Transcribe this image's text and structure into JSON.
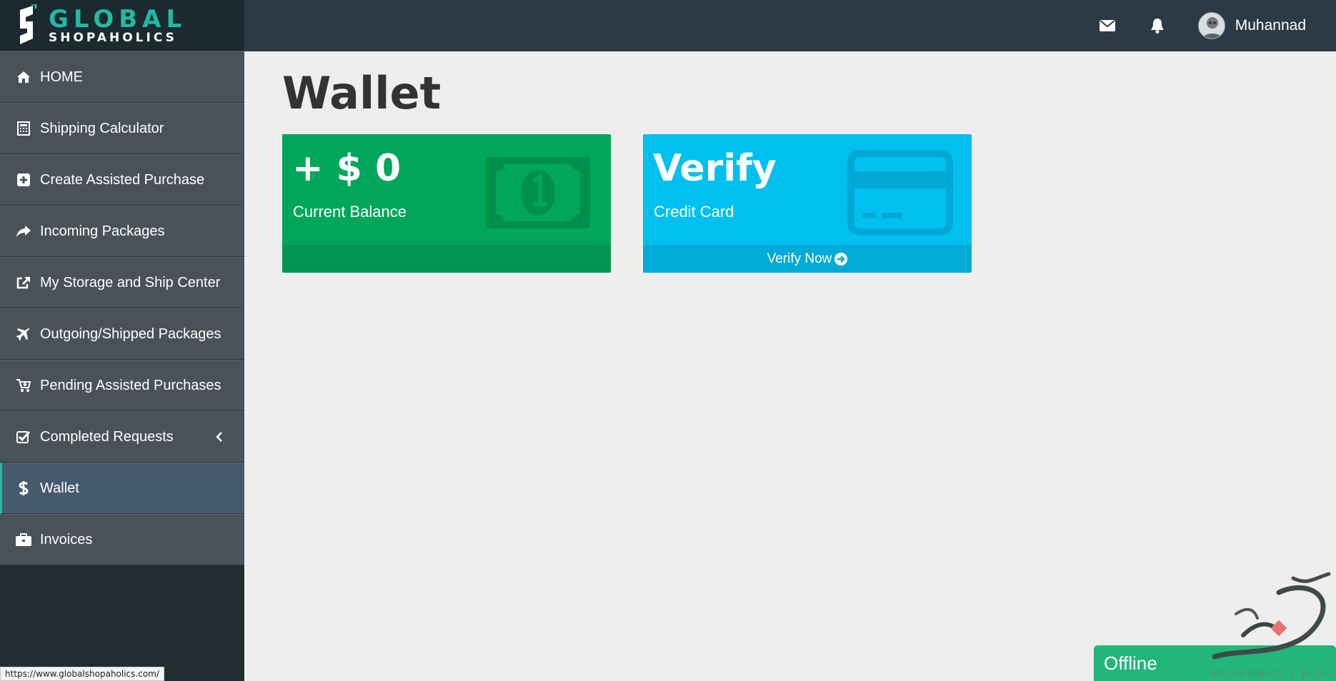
{
  "brand": {
    "line1": "GLOBAL",
    "line2": "SHOPAHOLICS"
  },
  "topbar": {
    "mail_icon": "envelope-icon",
    "bell_icon": "bell-icon",
    "user_name": "Muhannad"
  },
  "sidebar": {
    "items": [
      {
        "label": "HOME",
        "icon": "home-icon"
      },
      {
        "label": "Shipping Calculator",
        "icon": "calculator-icon"
      },
      {
        "label": "Create Assisted Purchase",
        "icon": "plus-square-icon"
      },
      {
        "label": "Incoming Packages",
        "icon": "share-arrow-icon"
      },
      {
        "label": "My Storage and Ship Center",
        "icon": "external-link-icon"
      },
      {
        "label": "Outgoing/Shipped Packages",
        "icon": "plane-icon"
      },
      {
        "label": "Pending Assisted Purchases",
        "icon": "cart-plus-icon"
      },
      {
        "label": "Completed Requests",
        "icon": "check-square-icon"
      },
      {
        "label": "Wallet",
        "icon": "dollar-icon",
        "active": true
      },
      {
        "label": "Invoices",
        "icon": "briefcase-icon"
      }
    ]
  },
  "main": {
    "title": "Wallet",
    "balance_card": {
      "value": "+ $ 0",
      "label": "Current Balance",
      "icon": "money-bill-icon",
      "color": "#00a65a"
    },
    "verify_card": {
      "value": "Verify",
      "label": "Credit Card",
      "footer": "Verify Now",
      "icon": "credit-card-icon",
      "color": "#00c0ef"
    }
  },
  "status_url": "https://www.globalshopaholics.com/",
  "chat": {
    "label": "Offline"
  },
  "watermark": {
    "text": "MUHANNAD'S BLOG"
  }
}
